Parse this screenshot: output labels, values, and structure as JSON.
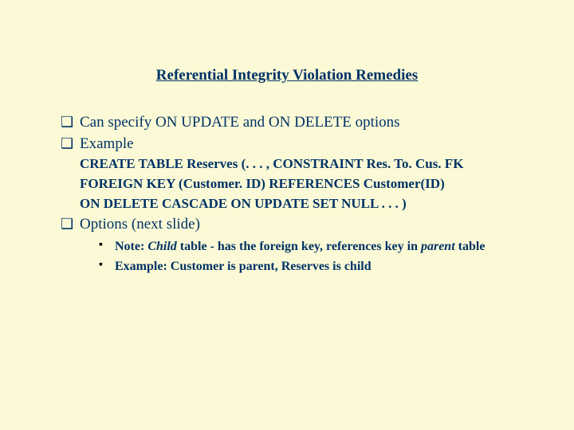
{
  "title": "Referential Integrity Violation Remedies",
  "bullets": {
    "b1": "Can specify ON UPDATE and ON DELETE options",
    "b2": "Example",
    "code1": "CREATE TABLE Reserves (. . . , CONSTRAINT Res. To. Cus. FK",
    "code2": "FOREIGN KEY (Customer. ID)  REFERENCES  Customer(ID)",
    "code3": "ON DELETE CASCADE  ON UPDATE SET NULL       . . . )",
    "b3": "Options (next slide)"
  },
  "sub": {
    "note_prefix": "Note: ",
    "note_child": "Child",
    "note_mid": " table - has the foreign key, references key in ",
    "note_parent": "parent",
    "note_suffix": " table",
    "ex": "Example: Customer is parent, Reserves is child"
  }
}
